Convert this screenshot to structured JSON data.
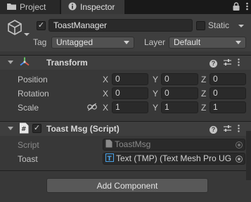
{
  "tabs": {
    "project": "Project",
    "inspector": "Inspector"
  },
  "header": {
    "object_name": "ToastManager",
    "active_checked": true,
    "static_label": "Static",
    "tag_label": "Tag",
    "tag_value": "Untagged",
    "layer_label": "Layer",
    "layer_value": "Default"
  },
  "transform": {
    "title": "Transform",
    "rows": [
      {
        "label": "Position",
        "x": "0",
        "y": "0",
        "z": "0"
      },
      {
        "label": "Rotation",
        "x": "0",
        "y": "0",
        "z": "0"
      },
      {
        "label": "Scale",
        "x": "1",
        "y": "1",
        "z": "1"
      }
    ],
    "axes": {
      "x": "X",
      "y": "Y",
      "z": "Z"
    }
  },
  "toast_script": {
    "title": "Toast Msg (Script)",
    "script_label": "Script",
    "script_value": "ToastMsg",
    "toast_label": "Toast",
    "toast_value": "Text (TMP) (Text Mesh Pro UG"
  },
  "add_component_label": "Add Component",
  "colors": {
    "background": "#383838",
    "header": "#3e3e3e",
    "field": "#2a2a2a",
    "tab_bar": "#191919"
  }
}
